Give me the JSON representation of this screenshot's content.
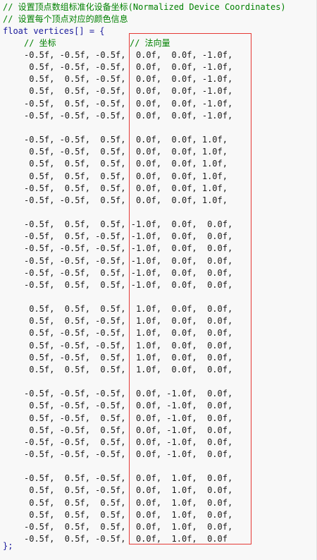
{
  "comments": {
    "line1": "// 设置顶点数组标准化设备坐标(Normalized Device Coordinates)",
    "line2": "// 设置每个顶点对应的颜色信息"
  },
  "declaration": "float vertices[] = {",
  "column_comments": {
    "coords": "// 坐标",
    "normals": "// 法向量"
  },
  "closing": "};",
  "vertex_rows": [
    "-0.5f, -0.5f, -0.5f,  0.0f,  0.0f, -1.0f,",
    " 0.5f, -0.5f, -0.5f,  0.0f,  0.0f, -1.0f,",
    " 0.5f,  0.5f, -0.5f,  0.0f,  0.0f, -1.0f,",
    " 0.5f,  0.5f, -0.5f,  0.0f,  0.0f, -1.0f,",
    "-0.5f,  0.5f, -0.5f,  0.0f,  0.0f, -1.0f,",
    "-0.5f, -0.5f, -0.5f,  0.0f,  0.0f, -1.0f,",
    "",
    "-0.5f, -0.5f,  0.5f,  0.0f,  0.0f, 1.0f,",
    " 0.5f, -0.5f,  0.5f,  0.0f,  0.0f, 1.0f,",
    " 0.5f,  0.5f,  0.5f,  0.0f,  0.0f, 1.0f,",
    " 0.5f,  0.5f,  0.5f,  0.0f,  0.0f, 1.0f,",
    "-0.5f,  0.5f,  0.5f,  0.0f,  0.0f, 1.0f,",
    "-0.5f, -0.5f,  0.5f,  0.0f,  0.0f, 1.0f,",
    "",
    "-0.5f,  0.5f,  0.5f, -1.0f,  0.0f,  0.0f,",
    "-0.5f,  0.5f, -0.5f, -1.0f,  0.0f,  0.0f,",
    "-0.5f, -0.5f, -0.5f, -1.0f,  0.0f,  0.0f,",
    "-0.5f, -0.5f, -0.5f, -1.0f,  0.0f,  0.0f,",
    "-0.5f, -0.5f,  0.5f, -1.0f,  0.0f,  0.0f,",
    "-0.5f,  0.5f,  0.5f, -1.0f,  0.0f,  0.0f,",
    "",
    " 0.5f,  0.5f,  0.5f,  1.0f,  0.0f,  0.0f,",
    " 0.5f,  0.5f, -0.5f,  1.0f,  0.0f,  0.0f,",
    " 0.5f, -0.5f, -0.5f,  1.0f,  0.0f,  0.0f,",
    " 0.5f, -0.5f, -0.5f,  1.0f,  0.0f,  0.0f,",
    " 0.5f, -0.5f,  0.5f,  1.0f,  0.0f,  0.0f,",
    " 0.5f,  0.5f,  0.5f,  1.0f,  0.0f,  0.0f,",
    "",
    "-0.5f, -0.5f, -0.5f,  0.0f, -1.0f,  0.0f,",
    " 0.5f, -0.5f, -0.5f,  0.0f, -1.0f,  0.0f,",
    " 0.5f, -0.5f,  0.5f,  0.0f, -1.0f,  0.0f,",
    " 0.5f, -0.5f,  0.5f,  0.0f, -1.0f,  0.0f,",
    "-0.5f, -0.5f,  0.5f,  0.0f, -1.0f,  0.0f,",
    "-0.5f, -0.5f, -0.5f,  0.0f, -1.0f,  0.0f,",
    "",
    "-0.5f,  0.5f, -0.5f,  0.0f,  1.0f,  0.0f,",
    " 0.5f,  0.5f, -0.5f,  0.0f,  1.0f,  0.0f,",
    " 0.5f,  0.5f,  0.5f,  0.0f,  1.0f,  0.0f,",
    " 0.5f,  0.5f,  0.5f,  0.0f,  1.0f,  0.0f,",
    "-0.5f,  0.5f,  0.5f,  0.0f,  1.0f,  0.0f,",
    "-0.5f,  0.5f, -0.5f,  0.0f,  1.0f,  0.0f"
  ],
  "colors": {
    "background": "#f8f8f8",
    "comment": "#008000",
    "keyword": "#1a1a9c",
    "text": "#1a1a1a",
    "highlight_border": "#e53935"
  }
}
